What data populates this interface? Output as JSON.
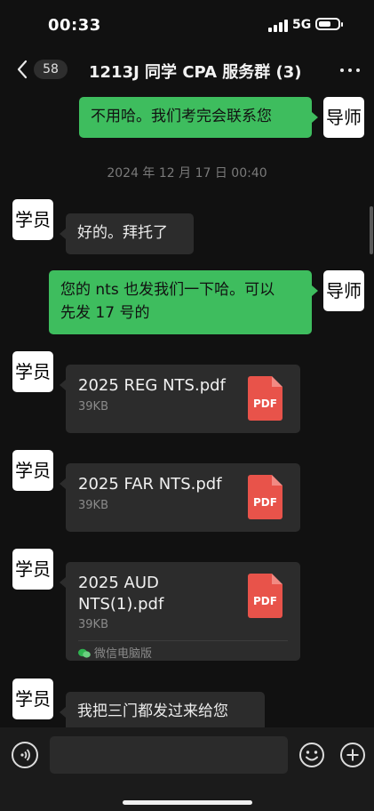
{
  "status": {
    "time": "00:33",
    "network": "5G"
  },
  "nav": {
    "unread": "58",
    "title": "1213J 同学 CPA 服务群 (3)"
  },
  "messages": {
    "m1": {
      "sender": "导师",
      "text": "不用哈。我们考完会联系您"
    },
    "timestamp": "2024 年 12 月 17 日 00:40",
    "m2": {
      "sender": "学员",
      "text": "好的。拜托了"
    },
    "m3": {
      "sender": "导师",
      "line1": "您的 nts 也发我们一下哈。可以",
      "line2": "先发 17 号的"
    },
    "f1": {
      "sender": "学员",
      "name": "2025 REG NTS.pdf",
      "size": "39KB",
      "icon": "PDF"
    },
    "f2": {
      "sender": "学员",
      "name": "2025 FAR NTS.pdf",
      "size": "39KB",
      "icon": "PDF"
    },
    "f3": {
      "sender": "学员",
      "name_line1": "2025 AUD",
      "name_line2": "NTS(1).pdf",
      "size": "39KB",
      "icon": "PDF",
      "source": "微信电脑版"
    },
    "m4": {
      "sender": "学员",
      "text": "我把三门都发过来给您"
    }
  },
  "input": {
    "placeholder": ""
  },
  "colors": {
    "outgoing_bubble": "#3ebd5e",
    "incoming_bubble": "#2c2c2c",
    "background": "#111111",
    "pdf_icon": "#e8534a"
  }
}
